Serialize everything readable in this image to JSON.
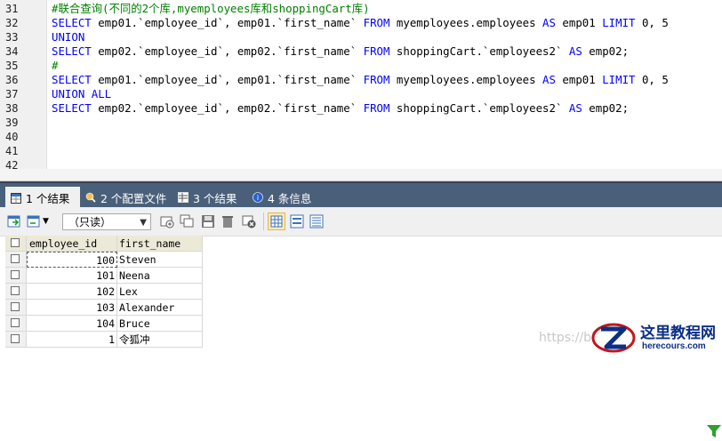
{
  "editor": {
    "lines": [
      {
        "num": "31",
        "parts": [
          {
            "t": "#联合查询(不同的2个库,myemployees库和shoppingCart库)",
            "c": "cm"
          }
        ]
      },
      {
        "num": "32",
        "parts": [
          {
            "t": "SELECT",
            "c": "kw"
          },
          {
            "t": " emp01.`employee_id`, emp01.`first_name` ",
            "c": ""
          },
          {
            "t": "FROM",
            "c": "kw"
          },
          {
            "t": " myemployees.employees ",
            "c": ""
          },
          {
            "t": "AS",
            "c": "kw"
          },
          {
            "t": " emp01 ",
            "c": ""
          },
          {
            "t": "LIMIT",
            "c": "kw"
          },
          {
            "t": " 0, 5",
            "c": ""
          }
        ]
      },
      {
        "num": "33",
        "parts": [
          {
            "t": "UNION",
            "c": "kw"
          }
        ]
      },
      {
        "num": "34",
        "parts": [
          {
            "t": "SELECT",
            "c": "kw"
          },
          {
            "t": " emp02.`employee_id`, emp02.`first_name` ",
            "c": ""
          },
          {
            "t": "FROM",
            "c": "kw"
          },
          {
            "t": " shoppingCart.`employees2` ",
            "c": ""
          },
          {
            "t": "AS",
            "c": "kw"
          },
          {
            "t": " emp02;",
            "c": ""
          }
        ]
      },
      {
        "num": "35",
        "parts": [
          {
            "t": "#",
            "c": "cm"
          }
        ]
      },
      {
        "num": "36",
        "parts": [
          {
            "t": "SELECT",
            "c": "kw"
          },
          {
            "t": " emp01.`employee_id`, emp01.`first_name` ",
            "c": ""
          },
          {
            "t": "FROM",
            "c": "kw"
          },
          {
            "t": " myemployees.employees ",
            "c": ""
          },
          {
            "t": "AS",
            "c": "kw"
          },
          {
            "t": " emp01 ",
            "c": ""
          },
          {
            "t": "LIMIT",
            "c": "kw"
          },
          {
            "t": " 0, 5",
            "c": ""
          }
        ]
      },
      {
        "num": "37",
        "parts": [
          {
            "t": "UNION ALL",
            "c": "kw"
          }
        ]
      },
      {
        "num": "38",
        "parts": [
          {
            "t": "SELECT",
            "c": "kw"
          },
          {
            "t": " emp02.`employee_id`, emp02.`first_name` ",
            "c": ""
          },
          {
            "t": "FROM",
            "c": "kw"
          },
          {
            "t": " shoppingCart.`employees2` ",
            "c": ""
          },
          {
            "t": "AS",
            "c": "kw"
          },
          {
            "t": " emp02;",
            "c": ""
          }
        ]
      },
      {
        "num": "39",
        "parts": []
      },
      {
        "num": "40",
        "parts": []
      },
      {
        "num": "41",
        "parts": []
      },
      {
        "num": "42",
        "parts": []
      }
    ]
  },
  "tabs": [
    {
      "label": "1 个结果",
      "active": true,
      "icon": "result-grid-icon"
    },
    {
      "label": "2 个配置文件",
      "active": false,
      "icon": "profile-icon"
    },
    {
      "label": "3 个结果",
      "active": false,
      "icon": "info-table-icon"
    },
    {
      "label": "4 条信息",
      "active": false,
      "icon": "messages-icon"
    }
  ],
  "toolbar": {
    "readonly_select": "（只读）"
  },
  "grid": {
    "columns": [
      "employee_id",
      "first_name"
    ],
    "rows": [
      [
        "100",
        "Steven"
      ],
      [
        "101",
        "Neena"
      ],
      [
        "102",
        "Lex"
      ],
      [
        "103",
        "Alexander"
      ],
      [
        "104",
        "Bruce"
      ],
      [
        "1",
        "令狐冲"
      ]
    ]
  },
  "watermark": "https://bl",
  "logo": {
    "title": "这里教程网",
    "subtitle": "herecours.com"
  },
  "colors": {
    "keyword": "#0000ff",
    "comment": "#008000",
    "tabbar": "#4a607a",
    "header": "#ece9d8",
    "logo": "#0b2f87"
  }
}
